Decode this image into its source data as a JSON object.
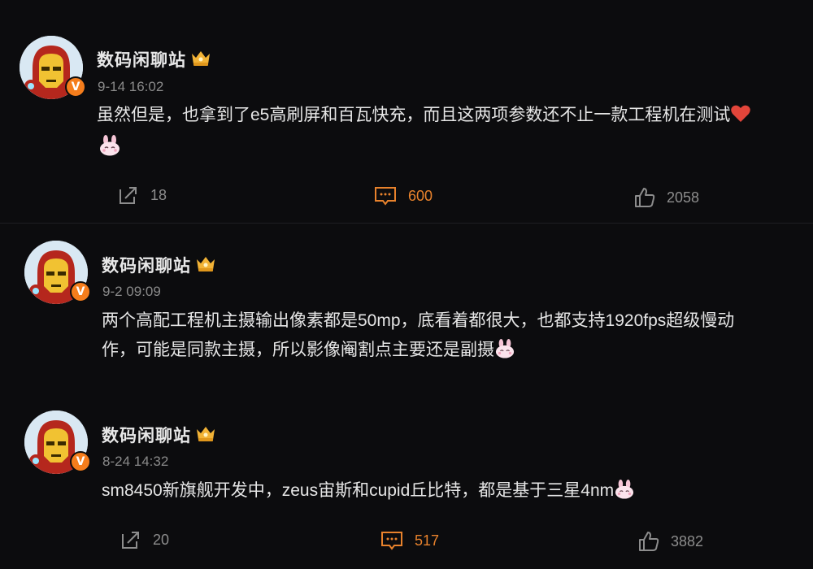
{
  "posts": [
    {
      "username": "数码闲聊站",
      "time": "9-14 16:02",
      "text": "虽然但是，也拿到了e5高刷屏和百瓦快充，而且这两项参数还不止一款工程机在测试",
      "forwards": "18",
      "comments": "600",
      "likes": "2058"
    },
    {
      "username": "数码闲聊站",
      "time": "9-2 09:09",
      "text_line1": "两个高配工程机主摄输出像素都是50mp，底看着都很大，也都支持1920fps超级慢动",
      "text_line2": "作，可能是同款主摄，所以影像阉割点主要还是副摄"
    },
    {
      "username": "数码闲聊站",
      "time": "8-24 14:32",
      "text": "sm8450新旗舰开发中，zeus宙斯和cupid丘比特，都是基于三星4nm",
      "forwards": "20",
      "comments": "517",
      "likes": "3882"
    }
  ],
  "badge": {
    "verified_letter": "V",
    "verified_color": "#f57d1c",
    "crown_color": "#f2b336"
  },
  "icons": [
    "forward-icon",
    "comment-icon",
    "like-icon",
    "heart-emoji",
    "rabbit-emoji",
    "crown-icon"
  ]
}
